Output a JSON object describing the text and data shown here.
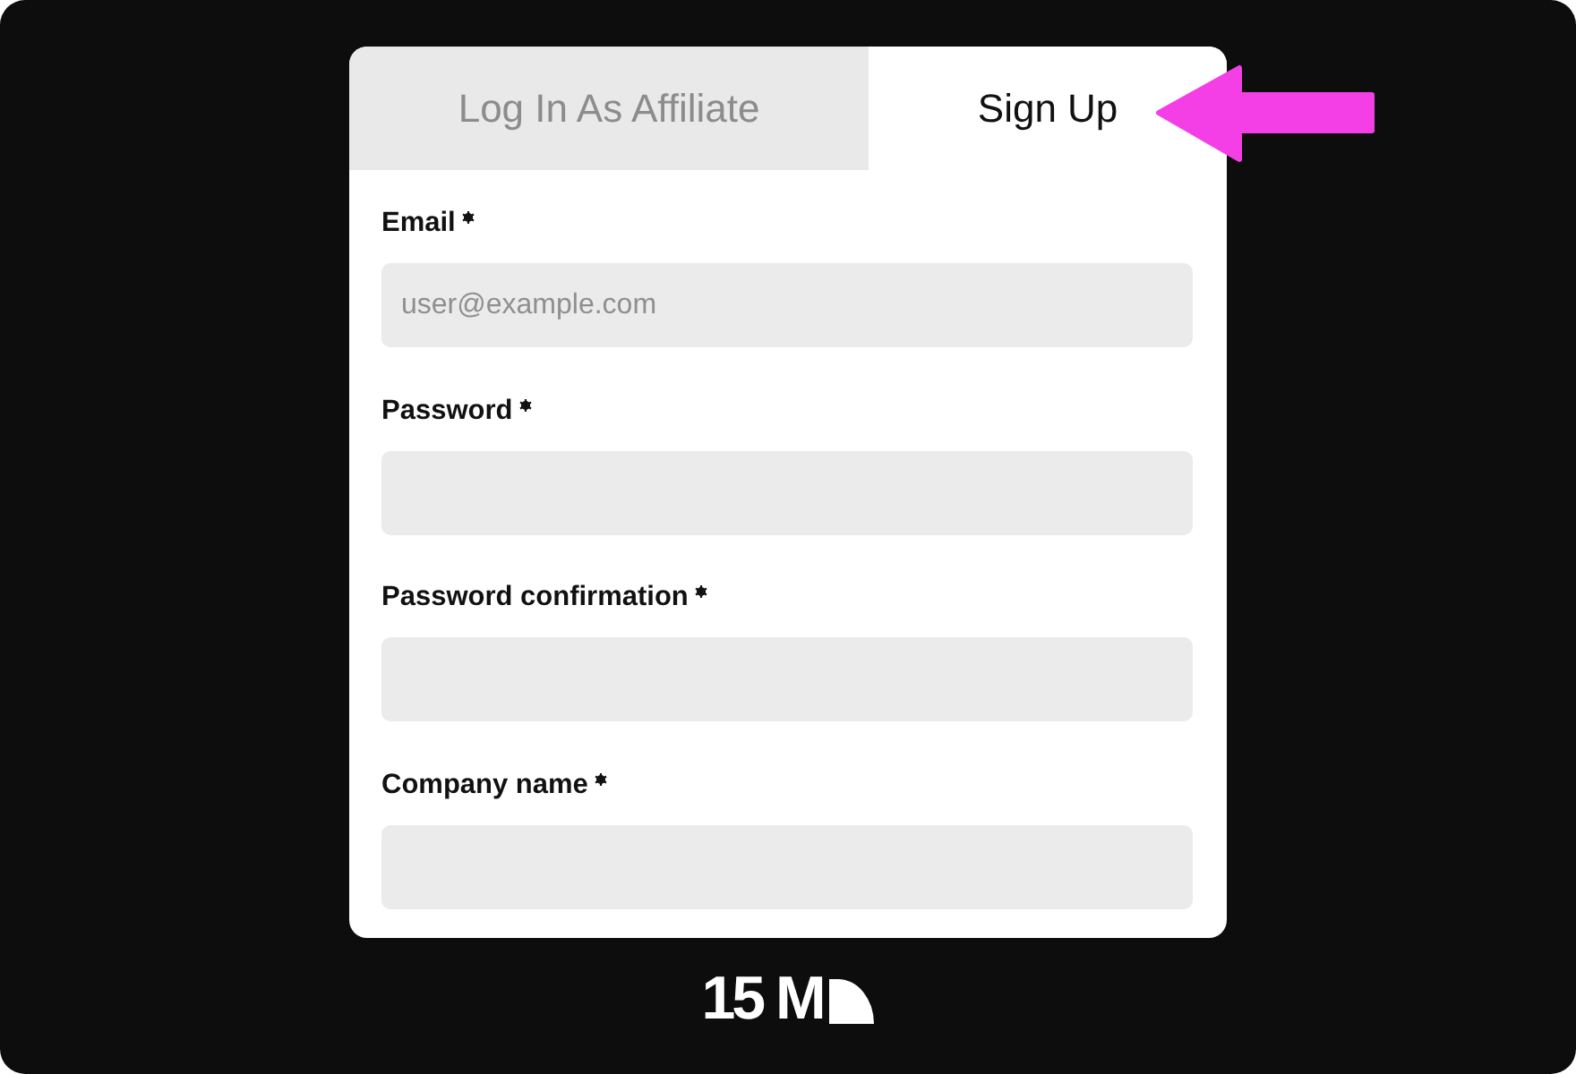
{
  "tabs": [
    {
      "label": "Log In As Affiliate",
      "selected": false
    },
    {
      "label": "Sign Up",
      "selected": true
    }
  ],
  "form": {
    "fields": [
      {
        "label": "Email",
        "required": true,
        "placeholder": "user@example.com"
      },
      {
        "label": "Password",
        "required": true
      },
      {
        "label": "Password confirmation",
        "required": true
      },
      {
        "label": "Company name",
        "required": true
      }
    ]
  },
  "footer": {
    "logo_text": "15 M"
  }
}
